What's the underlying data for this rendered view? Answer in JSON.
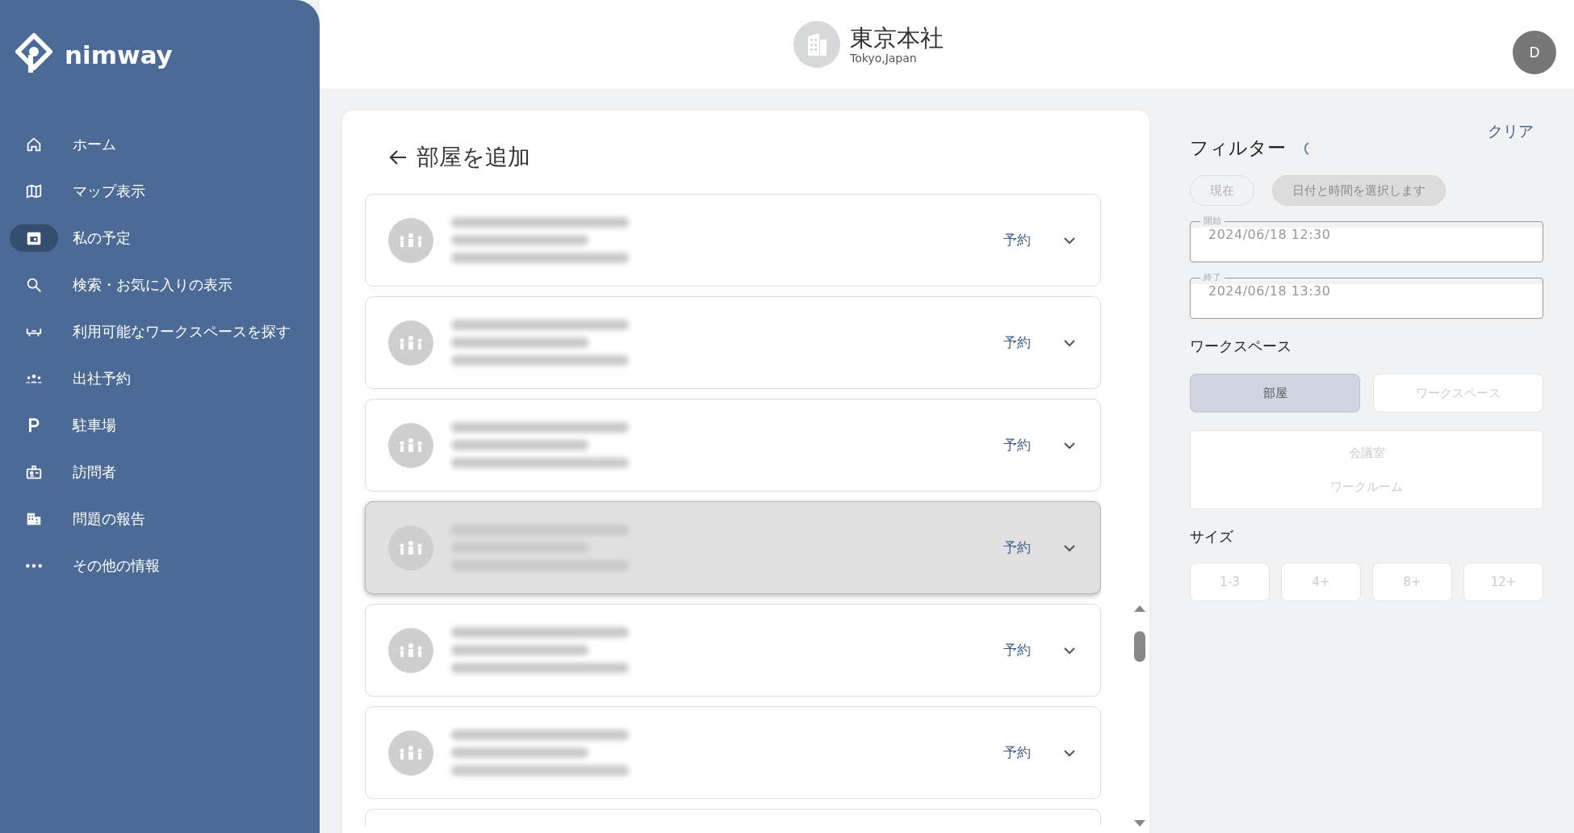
{
  "brand": {
    "name": "nimway"
  },
  "sidebar": {
    "items": [
      {
        "label": "ホーム",
        "kind": "home",
        "selected": false
      },
      {
        "label": "マップ表示",
        "kind": "map",
        "selected": false
      },
      {
        "label": "私の予定",
        "kind": "calendar",
        "selected": true
      },
      {
        "label": "検索・お気に入りの表示",
        "kind": "search",
        "selected": false
      },
      {
        "label": "利用可能なワークスペースを探す",
        "kind": "desk",
        "selected": false
      },
      {
        "label": "出社予約",
        "kind": "people",
        "selected": false
      },
      {
        "label": "駐車場",
        "kind": "parking",
        "selected": false
      },
      {
        "label": "訪問者",
        "kind": "badge",
        "selected": false
      },
      {
        "label": "問題の報告",
        "kind": "building",
        "selected": false
      },
      {
        "label": "その他の情報",
        "kind": "more",
        "selected": false
      }
    ]
  },
  "header": {
    "title": "東京本社",
    "subtitle": "Tokyo,Japan",
    "avatar": "D"
  },
  "main": {
    "title": "部屋を追加",
    "rooms": [
      {
        "action": "予約",
        "highlighted": false
      },
      {
        "action": "予約",
        "highlighted": false
      },
      {
        "action": "予約",
        "highlighted": false
      },
      {
        "action": "予約",
        "highlighted": true
      },
      {
        "action": "予約",
        "highlighted": false
      },
      {
        "action": "予約",
        "highlighted": false
      }
    ]
  },
  "filter": {
    "title": "フィルター",
    "clear": "クリア",
    "time_chips": [
      {
        "label": "現在",
        "selected": false
      },
      {
        "label": "日付と時間を選択します",
        "selected": true
      }
    ],
    "start": {
      "label": "開始",
      "value": "2024/06/18 12:30"
    },
    "end": {
      "label": "終了",
      "value": "2024/06/18 13:30"
    },
    "workspace_label": "ワークスペース",
    "workspace_types": [
      {
        "label": "部屋",
        "selected": true
      },
      {
        "label": "ワークスペース",
        "selected": false
      }
    ],
    "room_types": [
      "会議室",
      "ワークルーム"
    ],
    "size_label": "サイズ",
    "sizes": [
      {
        "label": "1-3",
        "selected": false
      },
      {
        "label": "4+",
        "selected": false
      },
      {
        "label": "8+",
        "selected": false
      },
      {
        "label": "12+",
        "selected": false
      }
    ]
  }
}
